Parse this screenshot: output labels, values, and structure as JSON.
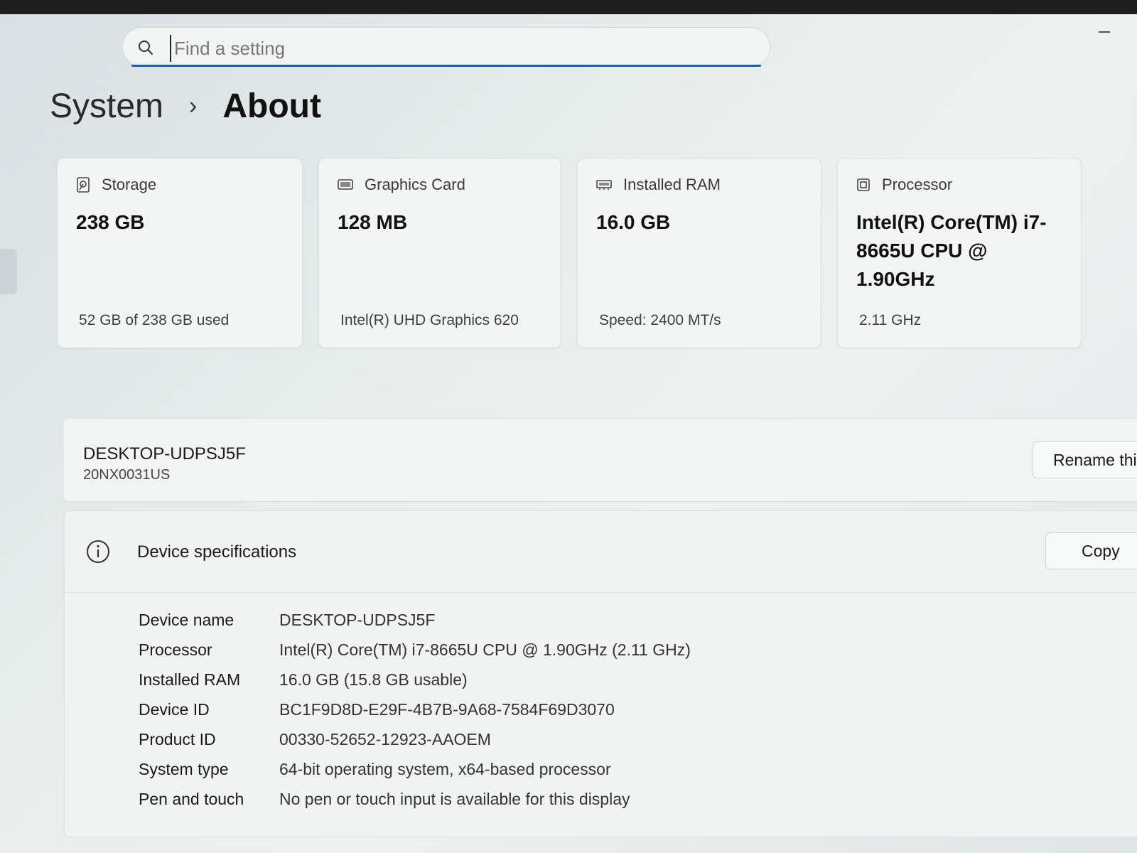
{
  "search": {
    "placeholder": "Find a setting"
  },
  "breadcrumb": {
    "parent": "System",
    "separator": "›",
    "current": "About"
  },
  "cards": [
    {
      "icon": "storage-icon",
      "label": "Storage",
      "value": "238 GB",
      "sub": "52 GB of 238 GB used"
    },
    {
      "icon": "graphics-card-icon",
      "label": "Graphics Card",
      "value": "128 MB",
      "sub": "Intel(R) UHD Graphics 620"
    },
    {
      "icon": "ram-icon",
      "label": "Installed RAM",
      "value": "16.0 GB",
      "sub": "Speed: 2400 MT/s"
    },
    {
      "icon": "processor-icon",
      "label": "Processor",
      "value": "Intel(R) Core(TM) i7-8665U CPU @ 1.90GHz",
      "sub": "2.11 GHz"
    }
  ],
  "device": {
    "name": "DESKTOP-UDPSJ5F",
    "model": "20NX0031US",
    "rename_label": "Rename thi"
  },
  "specs": {
    "title": "Device specifications",
    "copy_label": "Copy",
    "rows": [
      {
        "label": "Device name",
        "value": "DESKTOP-UDPSJ5F"
      },
      {
        "label": "Processor",
        "value": "Intel(R) Core(TM) i7-8665U CPU @ 1.90GHz (2.11 GHz)"
      },
      {
        "label": "Installed RAM",
        "value": "16.0 GB (15.8 GB usable)"
      },
      {
        "label": "Device ID",
        "value": "BC1F9D8D-E29F-4B7B-9A68-7584F69D3070"
      },
      {
        "label": "Product ID",
        "value": "00330-52652-12923-AAOEM"
      },
      {
        "label": "System type",
        "value": "64-bit operating system, x64-based processor"
      },
      {
        "label": "Pen and touch",
        "value": "No pen or touch input is available for this display"
      }
    ]
  },
  "colors": {
    "accent": "#1e5fb3",
    "background": "#e6ecea",
    "card": "#f3f5f5"
  }
}
